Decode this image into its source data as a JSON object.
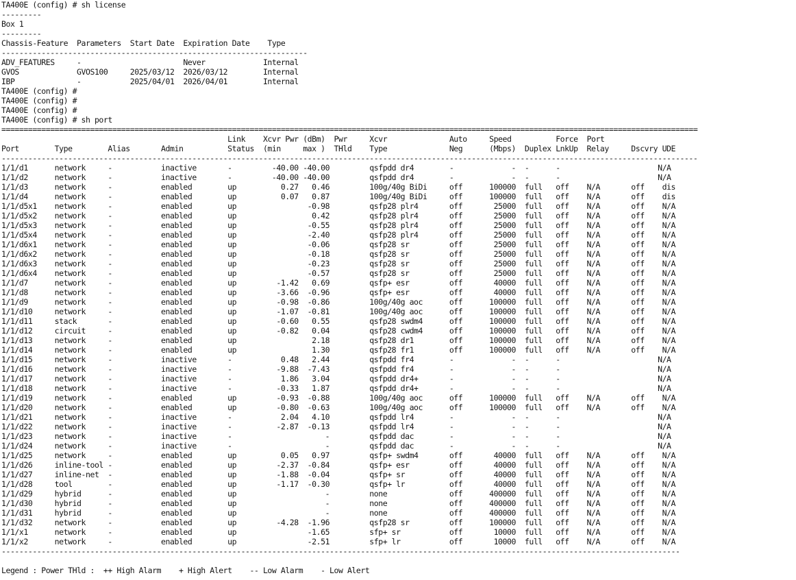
{
  "terminal": {
    "lines": [
      "TA400E (config) # sh license",
      "---------",
      "Box 1",
      "---------",
      "Chassis-Feature  Parameters  Start Date  Expiration Date    Type",
      "---------------------------------------------------------------------",
      "ADV_FEATURES     -                       Never             Internal",
      "GVOS             GVOS100     2025/03/12  2026/03/12        Internal",
      "IBP              -           2025/04/01  2026/04/01        Internal",
      "TA400E (config) #",
      "TA400E (config) #",
      "TA400E (config) #",
      "TA400E (config) # sh port",
      "=============================================================================================================================================================",
      "                                                   Link    Xcvr Pwr (dBm)  Pwr     Xcvr              Auto     Speed          Force  Port",
      "Port        Type        Alias       Admin          Status  (min     max )  THld    Type              Neg      (Mbps)  Duplex LnkUp  Relay     Dscvry UDE",
      "-------------------------------------------------------------------------------------------------------------------------------------------------------------",
      "1/1/d1      network     -           inactive       -         -40.00 -40.00         qsfpdd dr4        -             -  -      -                      N/A",
      "1/1/d2      network     -           inactive       -         -40.00 -40.00         qsfpdd dr4        -             -  -      -                      N/A",
      "1/1/d3      network     -           enabled        up          0.27   0.46         100g/40g BiDi     off      100000  full   off    N/A       off    dis",
      "1/1/d4      network     -           enabled        up          0.07   0.87         100g/40g BiDi     off      100000  full   off    N/A       off    dis",
      "1/1/d5x1    network     -           enabled        up                -0.98         qsfp28 plr4       off       25000  full   off    N/A       off    N/A",
      "1/1/d5x2    network     -           enabled        up                 0.42         qsfp28 plr4       off       25000  full   off    N/A       off    N/A",
      "1/1/d5x3    network     -           enabled        up                -0.55         qsfp28 plr4       off       25000  full   off    N/A       off    N/A",
      "1/1/d5x4    network     -           enabled        up                -2.40         qsfp28 plr4       off       25000  full   off    N/A       off    N/A",
      "1/1/d6x1    network     -           enabled        up                -0.06         qsfp28 sr         off       25000  full   off    N/A       off    N/A",
      "1/1/d6x2    network     -           enabled        up                -0.18         qsfp28 sr         off       25000  full   off    N/A       off    N/A",
      "1/1/d6x3    network     -           enabled        up                -0.23         qsfp28 sr         off       25000  full   off    N/A       off    N/A",
      "1/1/d6x4    network     -           enabled        up                -0.57         qsfp28 sr         off       25000  full   off    N/A       off    N/A",
      "1/1/d7      network     -           enabled        up         -1.42   0.69         qsfp+ esr         off       40000  full   off    N/A       off    N/A",
      "1/1/d8      network     -           enabled        up         -3.66  -0.96         qsfp+ esr         off       40000  full   off    N/A       off    N/A",
      "1/1/d9      network     -           enabled        up         -0.98  -0.86         100g/40g aoc      off      100000  full   off    N/A       off    N/A",
      "1/1/d10     network     -           enabled        up         -1.07  -0.81         100g/40g aoc      off      100000  full   off    N/A       off    N/A",
      "1/1/d11     stack       -           enabled        up         -0.60   0.55         qsfp28 swdm4      off      100000  full   off    N/A       off    N/A",
      "1/1/d12     circuit     -           enabled        up         -0.82   0.04         qsfp28 cwdm4      off      100000  full   off    N/A       off    N/A",
      "1/1/d13     network     -           enabled        up                 2.18         qsfp28 dr1        off      100000  full   off    N/A       off    N/A",
      "1/1/d14     network     -           enabled        up                 1.30         qsfp28 fr1        off      100000  full   off    N/A       off    N/A",
      "1/1/d15     network     -           inactive       -           0.48   2.44         qsfpdd fr4        -             -  -      -                      N/A",
      "1/1/d16     network     -           inactive       -          -9.88  -7.43         qsfpdd fr4        -             -  -      -                      N/A",
      "1/1/d17     network     -           inactive       -           1.86   3.04         qsfpdd dr4+       -             -  -      -                      N/A",
      "1/1/d18     network     -           inactive       -          -0.33   1.87         qsfpdd dr4+       -             -  -      -                      N/A",
      "1/1/d19     network     -           enabled        up         -0.93  -0.88         100g/40g aoc      off      100000  full   off    N/A       off    N/A",
      "1/1/d20     network     -           enabled        up         -0.80  -0.63         100g/40g aoc      off      100000  full   off    N/A       off    N/A",
      "1/1/d21     network     -           inactive       -           2.04   4.10         qsfpdd lr4        -             -  -      -                      N/A",
      "1/1/d22     network     -           inactive       -          -2.87  -0.13         qsfpdd lr4        -             -  -      -                      N/A",
      "1/1/d23     network     -           inactive       -                     -         qsfpdd dac        -             -  -      -                      N/A",
      "1/1/d24     network     -           inactive       -                     -         qsfpdd dac        -             -  -      -                      N/A",
      "1/1/d25     network     -           enabled        up          0.05   0.97         qsfp+ swdm4       off       40000  full   off    N/A       off    N/A",
      "1/1/d26     inline-tool -           enabled        up         -2.37  -0.84         qsfp+ esr         off       40000  full   off    N/A       off    N/A",
      "1/1/d27     inline-net  -           enabled        up         -1.88  -0.04         qsfp+ sr          off       40000  full   off    N/A       off    N/A",
      "1/1/d28     tool        -           enabled        up         -1.17  -0.30         qsfp+ lr          off       40000  full   off    N/A       off    N/A",
      "1/1/d29     hybrid      -           enabled        up                    -         none              off      400000  full   off    N/A       off    N/A",
      "1/1/d30     hybrid      -           enabled        up                    -         none              off      400000  full   off    N/A       off    N/A",
      "1/1/d31     hybrid      -           enabled        up                    -         none              off      400000  full   off    N/A       off    N/A",
      "1/1/d32     network     -           enabled        up         -4.28  -1.96         qsfp28 sr         off      100000  full   off    N/A       off    N/A",
      "1/1/x1      network     -           enabled        up                -1.65         sfp+ sr           off       10000  full   off    N/A       off    N/A",
      "1/1/x2      network     -           enabled        up                -2.51         sfp+ lr           off       10000  full   off    N/A       off    N/A",
      "---------------------------------------------------------------------------------------------------------------------------------------------------------",
      "",
      "Legend : Power THld :  ++ High Alarm    + High Alert    -- Low Alarm    - Low Alert"
    ]
  }
}
